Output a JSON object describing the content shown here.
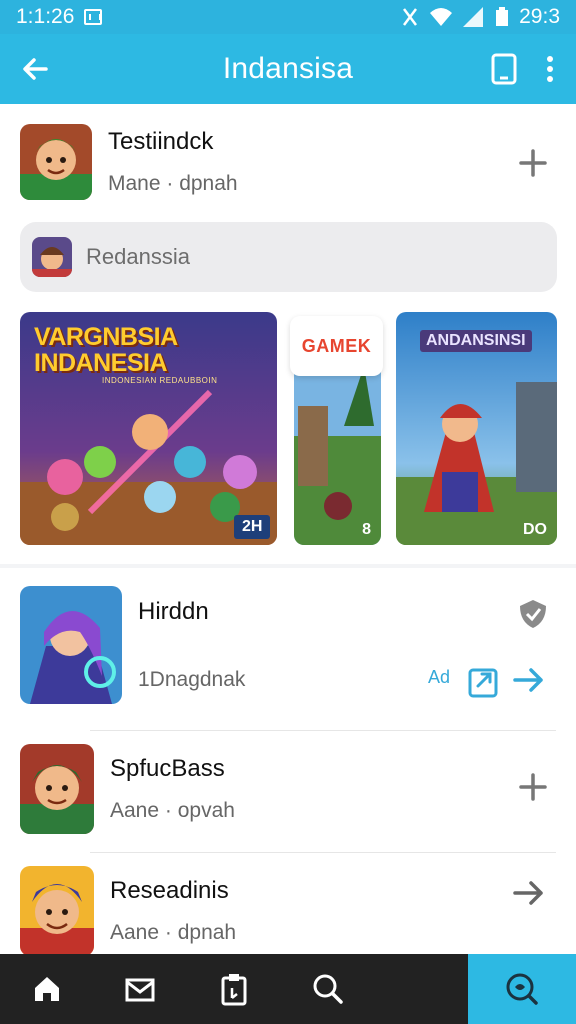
{
  "status_bar": {
    "time": "1:1:26",
    "battery_text": "29:3"
  },
  "app_bar": {
    "title": "Indansisa"
  },
  "top_card": {
    "name": "Testiindck",
    "subtitle": "Mane · dpnah"
  },
  "search": {
    "placeholder": "Redanssia"
  },
  "banners": {
    "main_title": "VARGNBSIA INDANESIA",
    "main_subtitle": "INDONESIAN REDAUBBOIN",
    "main_corner": "2H",
    "small_label": "GAMEK",
    "small_corner": "8",
    "right_title": "ANDANSINSI",
    "right_corner": "DO"
  },
  "list": {
    "items": [
      {
        "name": "Hirddn",
        "subtitle": "1Dnagdnak",
        "ad_label": "Ad"
      },
      {
        "name": "SpfucBass",
        "subtitle": "Aane · opvah"
      },
      {
        "name": "Reseadinis",
        "subtitle": "Aane · dpnah"
      }
    ]
  },
  "icons": {
    "back": "arrow-left-icon",
    "device": "tablet-icon",
    "more": "more-vert-icon",
    "add": "plus-icon",
    "shield": "shield-icon",
    "external": "external-icon",
    "forward": "arrow-right-icon",
    "home": "home-icon",
    "mail": "mail-icon",
    "clipboard": "clipboard-icon",
    "search": "search-icon",
    "search_active": "search-active-icon"
  },
  "colors": {
    "accent": "#2db9e3",
    "dark_bar": "#222222",
    "link": "#35a9d9"
  }
}
